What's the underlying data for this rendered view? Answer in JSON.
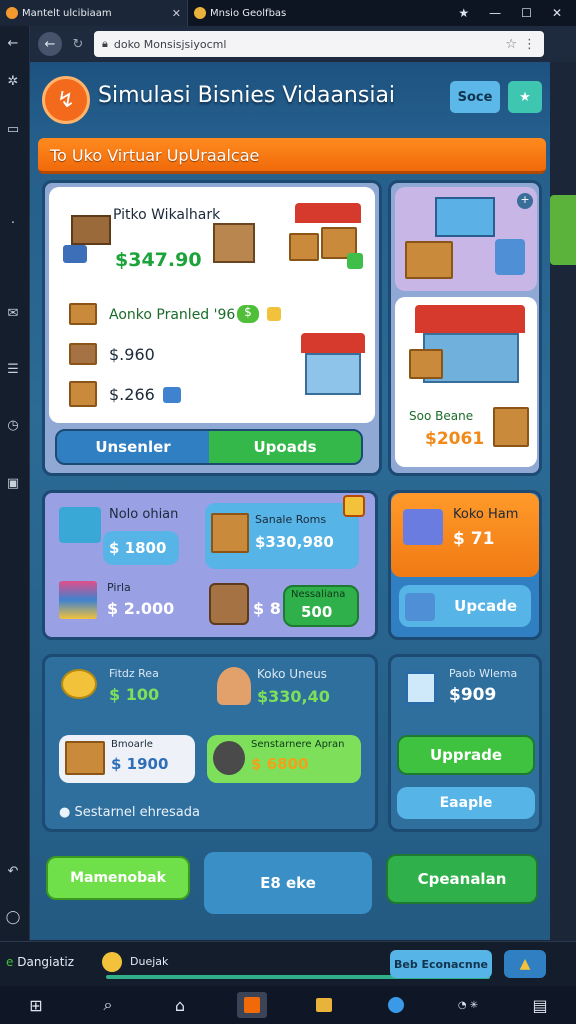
{
  "browser": {
    "tabs": [
      {
        "title": "Mantelt ulcibiaam"
      },
      {
        "title": "Mnsio Geolfbas"
      }
    ],
    "url": "doko Monsisjsiyocml",
    "window_controls": [
      "★",
      "—",
      "☐",
      "✕"
    ]
  },
  "game": {
    "title": "Simulasi Bisnies Vidaansiai",
    "top_buttons": [
      {
        "label": "Soce",
        "color": "#5bb8e8"
      },
      {
        "label": "★",
        "color": "#3fc6b0"
      }
    ],
    "banner": "To Uko Virtuar UpUraalcae",
    "shop_card": {
      "title": "Pitko Wikalhark",
      "price_main": "$347.90",
      "rows": [
        {
          "label": "Aonko Pranled '96",
          "badge": "$"
        },
        {
          "label": "$.960"
        },
        {
          "label": "$.266"
        }
      ],
      "toggle": {
        "left": "Unsenler",
        "right": "Upoads"
      }
    },
    "side_card": {
      "label": "Soo Beane",
      "price": "$2061"
    },
    "middle": {
      "truck_label": "Nolo ohian",
      "truck_price": "$ 1800",
      "crate_label": "Sanale Roms",
      "crate_price": "$330,980",
      "books_label": "Pirla",
      "books_price": "$ 2.000",
      "barrel_price": "$ 8",
      "green_btn_label": "Nessaliana",
      "green_btn_value": "500"
    },
    "orange_card": {
      "label": "Koko Ham",
      "price": "$ 71",
      "button": "Upcade"
    },
    "bottom_panel": {
      "coins_label": "Fitdz Rea",
      "coins_price": "$ 100",
      "person_label": "Koko Uneus",
      "person_price": "$330,40",
      "box_label": "Bmoarle",
      "box_price": "$ 1900",
      "bag_label": "Senstarnere Apran",
      "bag_price": "$ 6800",
      "footer": "Sestarnel ehresada"
    },
    "right_panel": {
      "label": "Paob Wlema",
      "price": "$909",
      "button1": "Upprade",
      "button2": "Eaaple"
    },
    "bottom_buttons": [
      {
        "label": "Mamenobak"
      },
      {
        "label": "E8 eke"
      },
      {
        "label": "Cpeanalan"
      }
    ]
  },
  "bottom_bar": {
    "left_label": "Dangiatiz",
    "mid_label": "Duejak",
    "right_button": "Beb Econacnne"
  },
  "colors": {
    "orange": "#f06a0a",
    "green": "#33b84a",
    "blue": "#3aa0d8"
  }
}
